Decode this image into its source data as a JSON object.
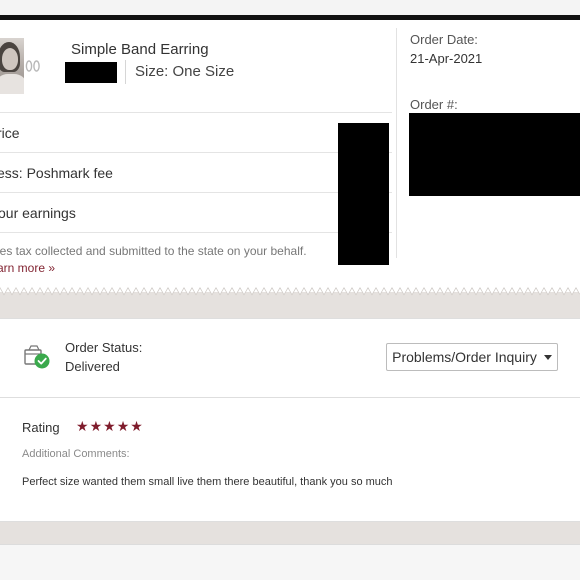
{
  "item": {
    "title": "Simple Band Earring",
    "size": "Size: One Size"
  },
  "breakdown": {
    "price_label": "rice",
    "fee_label": "ess: Poshmark fee",
    "earnings_label": "our earnings",
    "tax_note": "les tax collected and submitted to the state on your behalf.",
    "learn_more": "arn more »"
  },
  "order": {
    "date_label": "Order Date:",
    "date_value": "21-Apr-2021",
    "number_label": "Order #:"
  },
  "status": {
    "title": "Order Status:",
    "value": "Delivered",
    "inquiry_button": "Problems/Order Inquiry"
  },
  "rating": {
    "label": "Rating",
    "stars": 5,
    "star_glyph": "★",
    "comments_label": "Additional Comments:",
    "comment": "Perfect size wanted them small live them there beautiful, thank you so much"
  },
  "colors": {
    "brand": "#822432",
    "star": "#7f1c2c",
    "status_check": "#3aa94c",
    "background": "#e5e1de"
  }
}
